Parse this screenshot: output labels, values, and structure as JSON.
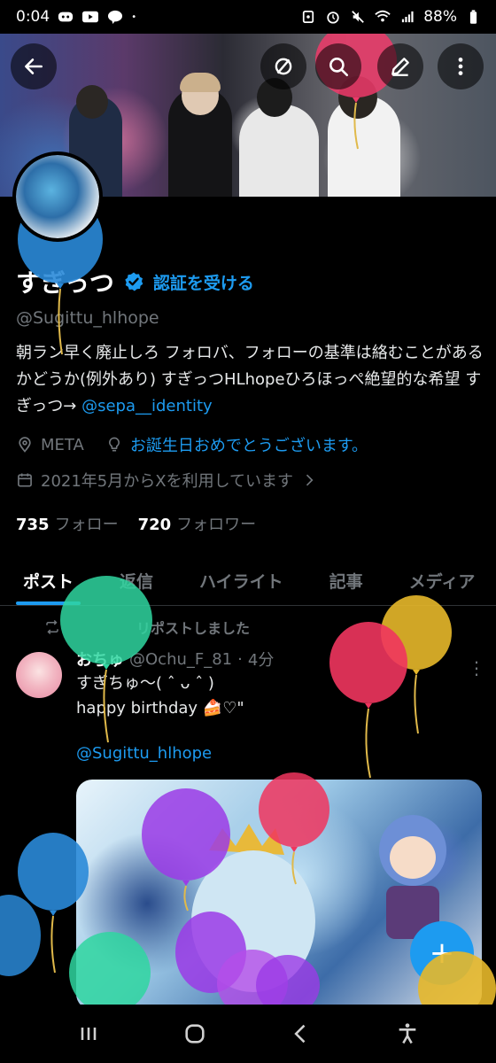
{
  "status_bar": {
    "time": "0:04",
    "battery": "88%"
  },
  "profile": {
    "name": "すぎっつ",
    "verify_label": "認証を受ける",
    "handle": "@Sugittu_hlhope",
    "bio_text": "朝ラン早く廃止しろ フォロバ、フォローの基準は絡むことがあるかどうか(例外あり) すぎっつHLhopeひろほっぺ絶望的な希望 すぎっつ→ ",
    "bio_mention": "@sepa__identity",
    "location": "META",
    "website": "お誕生日おめでとうございます。",
    "joined": "2021年5月からXを利用しています",
    "following_count": "735",
    "following_label": "フォロー",
    "followers_count": "720",
    "followers_label": "フォロワー"
  },
  "tabs": [
    {
      "label": "ポスト"
    },
    {
      "label": "返信"
    },
    {
      "label": "ハイライト"
    },
    {
      "label": "記事"
    },
    {
      "label": "メディア"
    }
  ],
  "tweet": {
    "repost_label": "リポストしました",
    "author_name": "おちゅ",
    "author_handle": "@Ochu_F_81",
    "time": "4分",
    "line1": "すぎちゅ〜( ˆ ᴗ ˆ )",
    "line2": "happy birthday 🍰♡\"",
    "link": "@Sugittu_hlhope"
  },
  "colors": {
    "accent": "#1d9bf0",
    "muted": "#71767b",
    "background": "#000000"
  },
  "icons": {
    "back": "arrow-left-icon",
    "sync": "sync-off-icon",
    "search": "search-icon",
    "edit": "edit-icon",
    "more": "more-vertical-icon",
    "verified": "verified-badge-icon",
    "location": "location-pin-icon",
    "website": "lightbulb-icon",
    "calendar": "calendar-icon",
    "repost": "repost-icon",
    "compose": "plus-icon"
  }
}
